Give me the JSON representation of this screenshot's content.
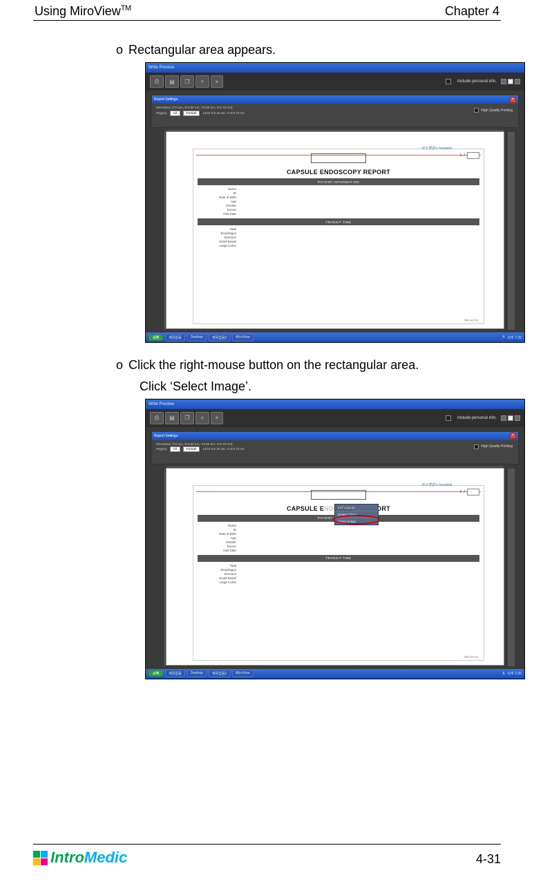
{
  "header": {
    "left": "Using MiroView",
    "tm": "TM",
    "right": "Chapter 4"
  },
  "steps": {
    "a_bullet": "o",
    "a_text": "Rectangular area appears.",
    "b_bullet": "o",
    "b_text": "Click the right-mouse button on the rectangular area.",
    "b_sub": "Click ‘Select Image’."
  },
  "figure": {
    "outer_title": "Write Preview",
    "toolbar": {
      "include_personal": "Include personal info.",
      "btn_close": "×"
    },
    "dialog": {
      "title": "Report Settings",
      "line1": "MiroView2: [T:0 sec, R:0.50 mA, T:0.50 mA, H:0.70 mA]",
      "row_labels": {
        "pages": "Page(s)",
        "pages_val": "All",
        "orient": "Portrait",
        "dur": "12/24 0:0.20 sec, H:0:8.70 mA"
      },
      "hq": "High Quality Printing"
    },
    "doc": {
      "hospital": "자소병원's hospital",
      "title": "CAPSULE ENDOSCOPY REPORT",
      "band1": "PATIENT INFORMATION",
      "pi": [
        "Name",
        "ID",
        "Date of Birth",
        "Age",
        "Gender",
        "Doctor",
        "Visit Date"
      ],
      "band2": "TRANSIT TIME",
      "tt": [
        "Total",
        "Esophagus",
        "Stomach",
        "Small Bowel",
        "Large Colon"
      ],
      "footer": "760 x8 cm"
    },
    "context_menu": [
      "Edit Caption",
      "Delete Object",
      "Select Image"
    ],
    "taskbar": {
      "tasks": [
        "제목없음",
        "Desktop",
        "제목없음2",
        "MiroView"
      ],
      "tray": "오후 7:35"
    }
  },
  "footer": {
    "brand_a": "Intro",
    "brand_b": "Medic",
    "page_num": "4-31"
  }
}
